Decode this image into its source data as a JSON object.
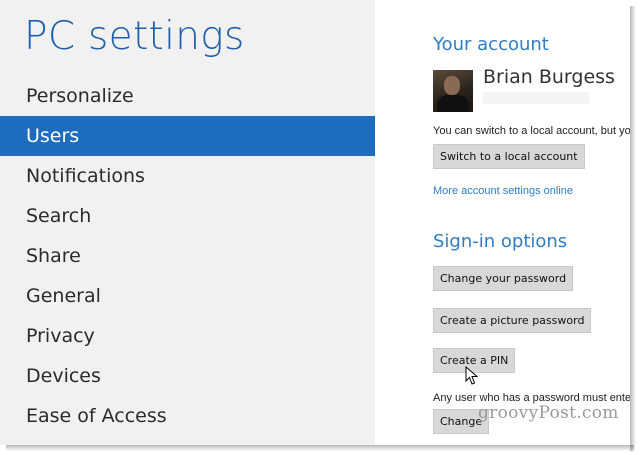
{
  "window": {
    "title": "PC settings"
  },
  "sidebar": {
    "items": [
      {
        "label": "Personalize"
      },
      {
        "label": "Users"
      },
      {
        "label": "Notifications"
      },
      {
        "label": "Search"
      },
      {
        "label": "Share"
      },
      {
        "label": "General"
      },
      {
        "label": "Privacy"
      },
      {
        "label": "Devices"
      },
      {
        "label": "Ease of Access"
      }
    ],
    "selected": "Users"
  },
  "account": {
    "heading": "Your account",
    "user_name": "Brian Burgess",
    "switch_text": "You can switch to a local account, but you",
    "switch_button": "Switch to a local account",
    "more_link": "More account settings online"
  },
  "signin": {
    "heading": "Sign-in options",
    "change_password_button": "Change your password",
    "picture_password_button": "Create a picture password",
    "pin_button": "Create a PIN",
    "note_text": "Any user who has a password must enter",
    "change_button": "Change"
  },
  "watermark": "groovyPost.com",
  "colors": {
    "accent": "#1c6cc0",
    "heading": "#2e7dc6",
    "title": "#1f5fad"
  }
}
